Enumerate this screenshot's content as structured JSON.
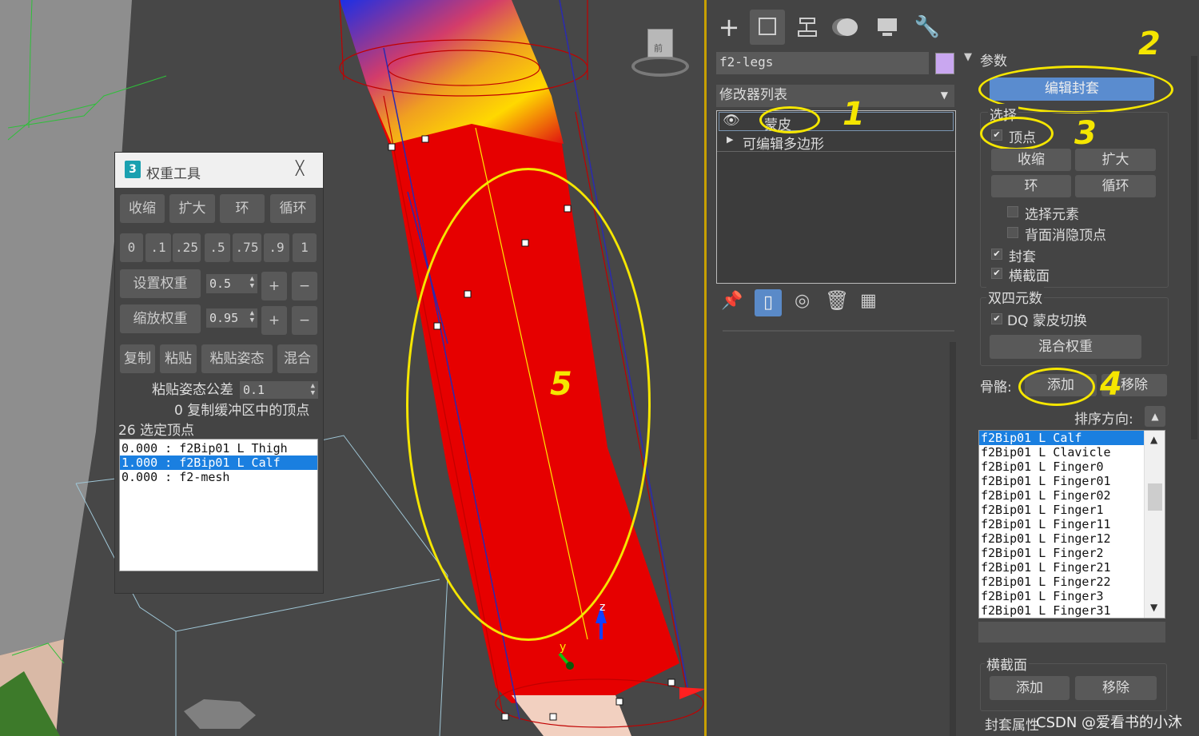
{
  "viewport": {
    "gizmo_y_label": "y",
    "gizmo_z_label": "z",
    "annotation_5": "5",
    "viewcube_label": "前"
  },
  "weight_tool": {
    "title": "权重工具",
    "close_glyph": "╳",
    "row1": [
      "收缩",
      "扩大",
      "环",
      "循环"
    ],
    "presets": [
      "0",
      ".1",
      ".25",
      ".5",
      ".75",
      ".9",
      "1"
    ],
    "set_weight_label": "设置权重",
    "set_weight_value": "0.5",
    "scale_weight_label": "缩放权重",
    "scale_weight_value": "0.95",
    "plus": "+",
    "minus": "−",
    "row4": [
      "复制",
      "粘贴",
      "粘贴姿态",
      "混合"
    ],
    "paste_tolerance_label": "粘贴姿态公差",
    "paste_tolerance_value": "0.1",
    "buffer_status": "0 复制缓冲区中的顶点",
    "selected_status": "26 选定顶点",
    "weight_list": [
      {
        "text": "0.000 : f2Bip01 L Thigh",
        "selected": false
      },
      {
        "text": "1.000 : f2Bip01 L Calf",
        "selected": true
      },
      {
        "text": "0.000 : f2-mesh",
        "selected": false
      }
    ]
  },
  "command_panel": {
    "tabs": [
      "create-tab",
      "modify-tab",
      "hierarchy-tab",
      "motion-tab",
      "display-tab",
      "utilities-tab"
    ],
    "object_name": "f2-legs",
    "object_color": "#c9a7f0",
    "modifier_list_label": "修改器列表",
    "stack": [
      {
        "label": "蒙皮",
        "annotation": "1"
      },
      {
        "label": "可编辑多边形"
      }
    ]
  },
  "params": {
    "rollout_title": "参数",
    "edit_envelope": "编辑封套",
    "annotation_2": "2",
    "select_group": "选择",
    "vertices_label": "顶点",
    "annotation_3": "3",
    "shrink": "收缩",
    "grow": "扩大",
    "ring": "环",
    "loop": "循环",
    "select_element": "选择元素",
    "backface_cull": "背面消隐顶点",
    "envelopes": "封套",
    "cross_sections": "横截面",
    "dq_group": "双四元数",
    "dq_skinning": "DQ 蒙皮切换",
    "blend_weights": "混合权重",
    "bones_label": "骨骼:",
    "add_bone": "添加",
    "remove_bone": "移除",
    "annotation_4": "4",
    "sort_label": "排序方向:",
    "bones": [
      {
        "name": "f2Bip01 L Calf",
        "selected": true
      },
      {
        "name": "f2Bip01 L Clavicle"
      },
      {
        "name": "f2Bip01 L Finger0"
      },
      {
        "name": "f2Bip01 L Finger01"
      },
      {
        "name": "f2Bip01 L Finger02"
      },
      {
        "name": "f2Bip01 L Finger1"
      },
      {
        "name": "f2Bip01 L Finger11"
      },
      {
        "name": "f2Bip01 L Finger12"
      },
      {
        "name": "f2Bip01 L Finger2"
      },
      {
        "name": "f2Bip01 L Finger21"
      },
      {
        "name": "f2Bip01 L Finger22"
      },
      {
        "name": "f2Bip01 L Finger3"
      },
      {
        "name": "f2Bip01 L Finger31"
      }
    ],
    "cross_section_group": "横截面",
    "cs_add": "添加",
    "cs_remove": "移除",
    "envelope_props": "封套属性"
  },
  "watermark": "CSDN @爱看书的小沐"
}
